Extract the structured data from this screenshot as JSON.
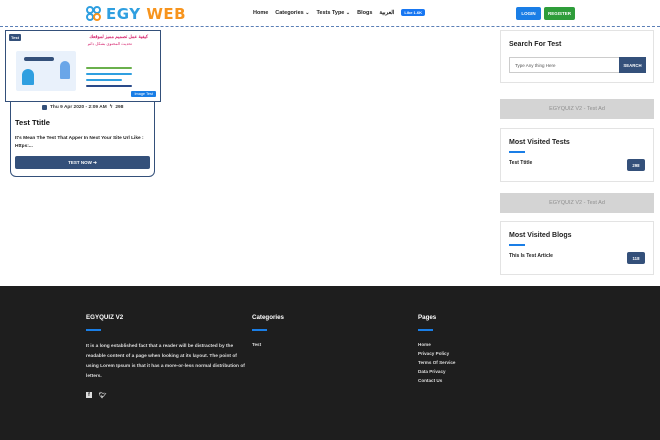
{
  "header": {
    "logo": {
      "part1": "EGY",
      "part2": " WEB"
    },
    "nav": [
      {
        "label": "Home",
        "dropdown": false
      },
      {
        "label": "Categories",
        "dropdown": true
      },
      {
        "label": "Tests Type",
        "dropdown": true
      },
      {
        "label": "Blogs",
        "dropdown": false
      },
      {
        "label": "العربية",
        "dropdown": false
      }
    ],
    "fb_like": "Like 1.6K",
    "login": "LOGIN",
    "register": "REGISTER"
  },
  "card": {
    "image": {
      "badge": "Test",
      "headline": "كيفية عمل تصميم مميز لموقعك",
      "subline": "تحديث المحتوى بشكل دائم",
      "button": "Image Test"
    },
    "date": "Thu 9 Apr 2020 - 2:09 AM",
    "views": "298",
    "title": "Test Ttitle",
    "description": "It's Mean The Test That Apper In Next Your Site Url Like : Https:...",
    "button": "TEST NOW ➔"
  },
  "sidebar": {
    "search": {
      "title": "Search For Test",
      "placeholder": "Type Any thing Here",
      "button": "SEARCH"
    },
    "ad1": "EGYQUIZ V2 - Test Ad",
    "most_visited_tests": {
      "title": "Most Visited Tests",
      "items": [
        {
          "label": "Test Ttitle",
          "count": "298"
        }
      ]
    },
    "ad2": "EGYQUIZ V2 - Test Ad",
    "most_visited_blogs": {
      "title": "Most Visited Blogs",
      "items": [
        {
          "label": "This Is Test Article",
          "count": "118"
        }
      ]
    }
  },
  "footer": {
    "about": {
      "title": "EGYQUIZ V2",
      "text": "It is a long established fact that a reader will be distracted by the readable content of a page when looking at its layout. The point of using Lorem Ipsum is that it has a more-or-less normal distribution of letters."
    },
    "categories": {
      "title": "Categories",
      "links": [
        "Test"
      ]
    },
    "pages": {
      "title": "Pages",
      "links": [
        "Home",
        "Privacy Policy",
        "Terms Of Service",
        "Data Privacy",
        "Contact Us"
      ]
    },
    "social": [
      "facebook-icon",
      "twitter-icon"
    ]
  },
  "colors": {
    "primary": "#34507a",
    "accent": "#1a7ee6",
    "success": "#2e9d3a",
    "footer_bg": "#1e1e1e"
  }
}
